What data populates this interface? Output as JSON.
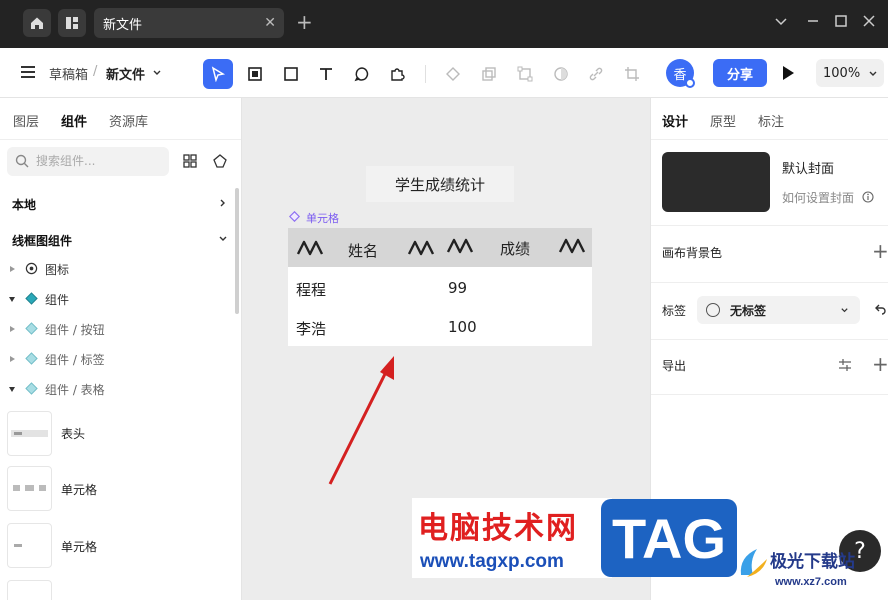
{
  "titlebar": {
    "tab_title": "新文件",
    "tab_close": "✕",
    "tab_add": "+",
    "win_min": "—",
    "win_max": "☐",
    "win_close": "✕",
    "chevron": "⌄"
  },
  "toolbar": {
    "crumb_drafts": "草稿箱",
    "crumb_sep": "/",
    "crumb_file": "新文件",
    "avatar_char": "香",
    "share_label": "分享",
    "zoom_label": "100%",
    "active_tool": "select"
  },
  "left_panel": {
    "tabs": [
      "图层",
      "组件",
      "资源库"
    ],
    "active_tab": "组件",
    "search_placeholder": "搜索组件...",
    "section_local": "本地",
    "section_wireframe": "线框图组件",
    "tree": [
      {
        "label": "图标"
      },
      {
        "label": "组件"
      },
      {
        "label": "组件 / 按钮"
      },
      {
        "label": "组件 / 标签"
      },
      {
        "label": "组件 / 表格"
      }
    ],
    "thumbs": [
      {
        "label": "表头"
      },
      {
        "label": "单元格"
      },
      {
        "label": "单元格"
      }
    ]
  },
  "canvas": {
    "frame_title": "学生成绩统计",
    "component_label": "单元格",
    "table": {
      "headers": [
        "姓名",
        "成绩"
      ],
      "rows": [
        [
          "程程",
          "99"
        ],
        [
          "李浩",
          "100"
        ]
      ]
    }
  },
  "right_panel": {
    "tabs": [
      "设计",
      "原型",
      "标注"
    ],
    "active_tab": "设计",
    "cover_title": "默认封面",
    "cover_hint": "如何设置封面",
    "canvas_bg_label": "画布背景色",
    "tags_label": "标签",
    "tags_value": "无标签",
    "export_label": "导出",
    "plus": "+"
  },
  "help_label": "?",
  "watermark": {
    "cn_text": "电脑技术网",
    "url": "www.tagxp.com",
    "tag": "TAG",
    "jg_text": "极光下载站",
    "jg_url": "www.xz7.com"
  },
  "colors": {
    "accent": "#3b6cf5",
    "titlebar": "#232323",
    "component_purple": "#7b5cf0"
  },
  "icons": [
    "home-icon",
    "layout-icon",
    "menu-icon",
    "select-tool-icon",
    "frame-tool-icon",
    "rect-tool-icon",
    "text-tool-icon",
    "comment-tool-icon",
    "plugin-tool-icon",
    "component-icon",
    "boolean-icon",
    "constraints-icon",
    "mask-icon",
    "link-icon",
    "crop-icon",
    "play-icon",
    "grid-icon",
    "component-set-icon",
    "settings-icon",
    "info-icon",
    "undo-icon",
    "export-config-icon"
  ]
}
